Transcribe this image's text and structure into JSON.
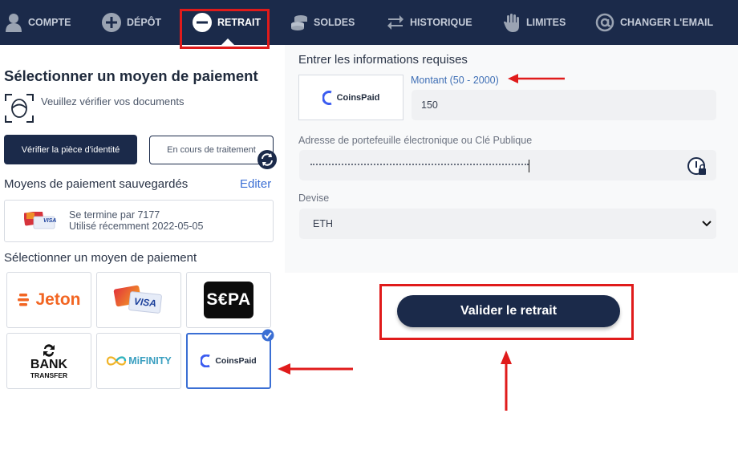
{
  "nav": {
    "items": [
      {
        "label": "COMPTE",
        "icon": "user-icon"
      },
      {
        "label": "DÉPÔT",
        "icon": "plus-circle-icon"
      },
      {
        "label": "RETRAIT",
        "icon": "minus-circle-icon",
        "active": true
      },
      {
        "label": "SOLDES",
        "icon": "coins-icon"
      },
      {
        "label": "HISTORIQUE",
        "icon": "swap-arrows-icon"
      },
      {
        "label": "LIMITES",
        "icon": "hand-icon"
      },
      {
        "label": "CHANGER L'EMAIL",
        "icon": "at-icon"
      }
    ]
  },
  "left": {
    "title": "Sélectionner un moyen de paiement",
    "verify_text": "Veuillez vérifier vos documents",
    "verify_button": "Vérifier la pièce d'identité",
    "status_button": "En cours de traitement",
    "saved_title": "Moyens de paiement sauvegardés",
    "edit_label": "Editer",
    "saved_card": {
      "line1": "Se termine par 7177",
      "line2": "Utilisé récemment 2022-05-05",
      "card_text": "VISA"
    },
    "methods_title": "Sélectionner un moyen de paiement",
    "methods": [
      {
        "name": "Jeton",
        "logo_text": "Jeton"
      },
      {
        "name": "Visa",
        "logo_text": "VISA"
      },
      {
        "name": "SEPA",
        "logo_text": "S€PA"
      },
      {
        "name": "Bank Transfer",
        "logo_text_1": "BANK",
        "logo_text_2": "TRANSFER"
      },
      {
        "name": "MiFinity",
        "logo_text": "MiFINITY"
      },
      {
        "name": "CoinsPaid",
        "logo_text": "CoinsPaid",
        "selected": true
      }
    ]
  },
  "right": {
    "title": "Entrer les informations requises",
    "provider_logo": "CoinsPaid",
    "amount_label": "Montant (50 - 2000)",
    "amount_value": "150",
    "wallet_label": "Adresse de portefeuille électronique ou Clé Publique",
    "currency_label": "Devise",
    "currency_value": "ETH",
    "submit_label": "Valider le retrait"
  },
  "colors": {
    "nav_bg": "#1b2a4a",
    "accent_blue": "#3b6fd4",
    "highlight_red": "#e01b1b",
    "jeton_orange": "#f26522"
  }
}
